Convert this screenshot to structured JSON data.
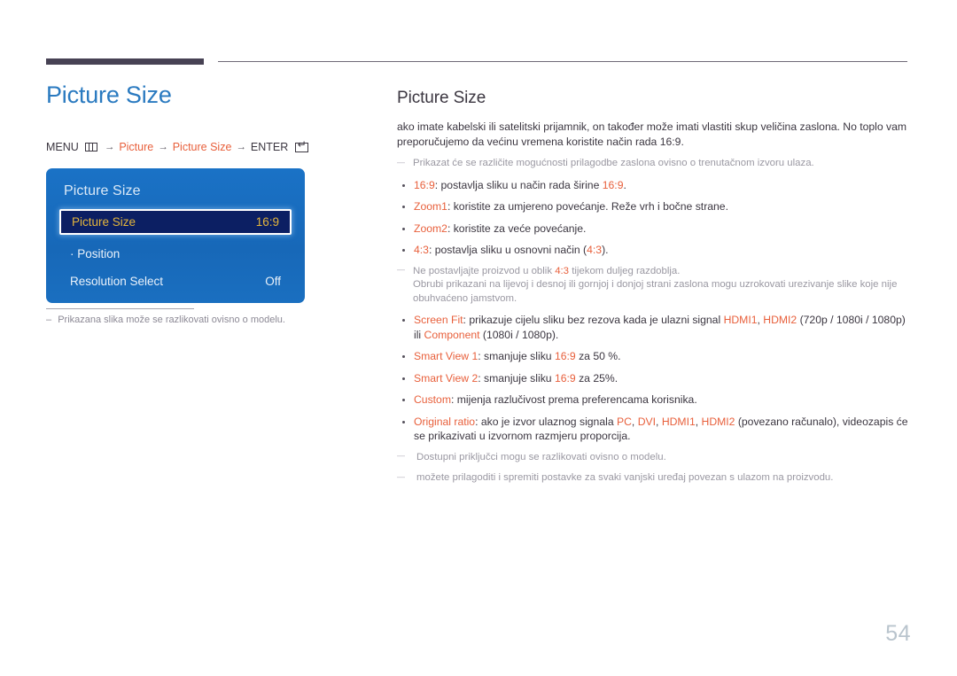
{
  "header": {
    "left_title": "Picture Size",
    "right_title": "Picture Size"
  },
  "breadcrumb": {
    "menu_label": "MENU",
    "menu_icon": "menu-grid-icon",
    "arrow": "→",
    "item1": "Picture",
    "item2": "Picture Size",
    "enter_label": "ENTER",
    "enter_icon": "enter-return-icon"
  },
  "osd": {
    "title": "Picture Size",
    "rows": [
      {
        "label": "Picture Size",
        "value": "16:9",
        "selected": true
      },
      {
        "label": "Position",
        "value": "",
        "sub": true
      },
      {
        "label": "Resolution Select",
        "value": "Off"
      }
    ]
  },
  "left_footnote": "Prikazana slika može se razlikovati ovisno o modelu.",
  "body": {
    "intro": "ako imate kabelski ili satelitski prijamnik, on također može imati vlastiti skup veličina zaslona. No toplo vam preporučujemo da većinu vremena koristite način rada 16:9.",
    "note_intro": "Prikazat će se različite mogućnosti prilagodbe zaslona ovisno o trenutačnom izvoru ulaza.",
    "bullets": [
      {
        "term": "16:9",
        "rest_a": ": postavlja sliku u način rada širine ",
        "accent2": "16:9",
        "rest_b": "."
      },
      {
        "term": "Zoom1",
        "rest_a": ": koristite za umjereno povećanje. Reže vrh i bočne strane.",
        "accent2": "",
        "rest_b": ""
      },
      {
        "term": "Zoom2",
        "rest_a": ": koristite za veće povećanje.",
        "accent2": "",
        "rest_b": ""
      },
      {
        "term": "4:3",
        "rest_a": ": postavlja sliku u osnovni način (",
        "accent2": "4:3",
        "rest_b": ")."
      }
    ],
    "note_43_line1_a": "Ne postavljajte proizvod u oblik ",
    "note_43_accent": "4:3",
    "note_43_line1_b": " tijekom duljeg razdoblja.",
    "note_43_line2": "Obrubi prikazani na lijevoj i desnoj ili gornjoj i donjoj strani zaslona mogu uzrokovati urezivanje slike koje nije obuhvaćeno jamstvom.",
    "screenfit": {
      "term": "Screen Fit",
      "a": ": prikazuje cijelu sliku bez rezova kada je ulazni signal ",
      "src1": "HDMI1",
      "sep1": ", ",
      "src2": "HDMI2",
      "b": " (720p / 1080i / 1080p) ili ",
      "src3": "Component",
      "c": " (1080i / 1080p)."
    },
    "smartview1": {
      "term": "Smart View 1",
      "a": ": smanjuje sliku ",
      "accent2": "16:9",
      "b": " za 50 %."
    },
    "smartview2": {
      "term": "Smart View 2",
      "a": ": smanjuje sliku ",
      "accent2": "16:9",
      "b": " za 25%."
    },
    "custom": {
      "term": "Custom",
      "a": ": mijenja razlučivost prema preferencama korisnika."
    },
    "original": {
      "term": "Original ratio",
      "a": ": ako je izvor ulaznog signala ",
      "src1": "PC",
      "sep1": ", ",
      "src2": "DVI",
      "sep2": ", ",
      "src3": "HDMI1",
      "sep3": ", ",
      "src4": "HDMI2",
      "b": " (povezano računalo), videozapis će se prikazivati u izvornom razmjeru proporcija."
    },
    "note_ports": "Dostupni priključci mogu se razlikovati ovisno o modelu.",
    "note_save": "možete prilagoditi i spremiti postavke za svaki vanjski uređaj povezan s ulazom na proizvodu."
  },
  "page_number": "54",
  "colors": {
    "accent": "#e8603c",
    "title_blue": "#2a7ac0",
    "osd_blue": "#1a6fc0",
    "osd_selected_bg": "#0c1f63",
    "osd_selected_text": "#e3b53c",
    "rule_dark": "#474254",
    "page_num": "#b9c4cd"
  }
}
